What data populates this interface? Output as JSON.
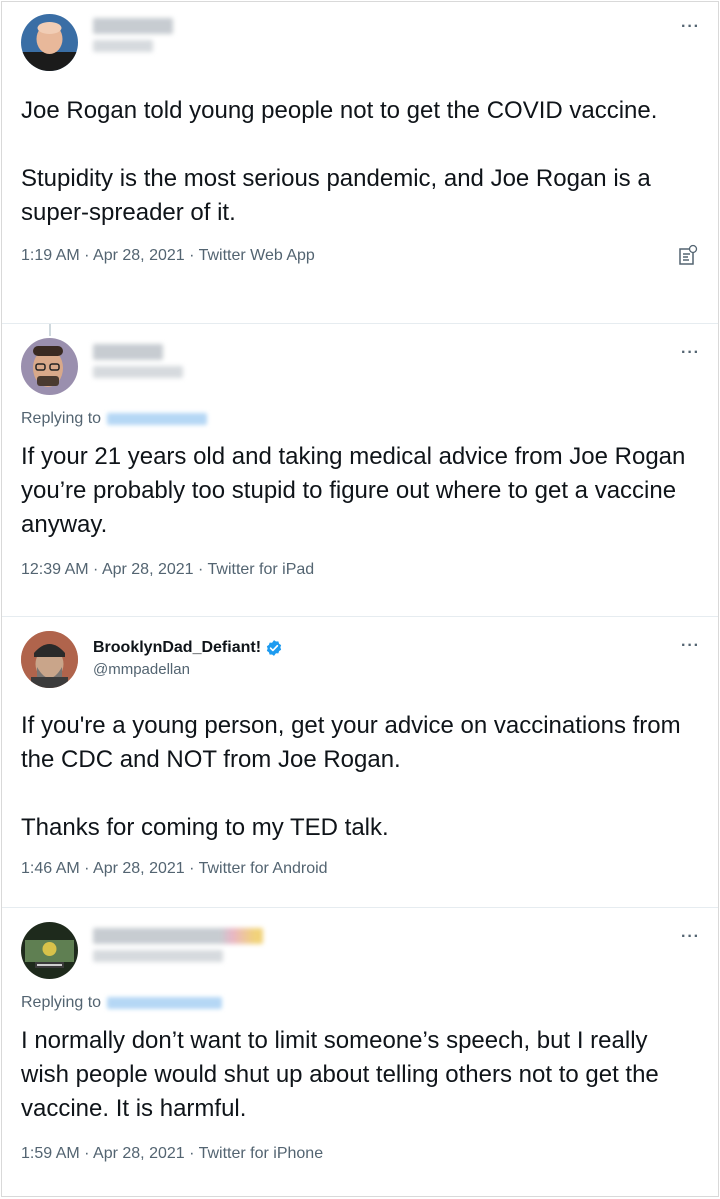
{
  "tweets": [
    {
      "display_name": "",
      "handle": "",
      "replying_to": "",
      "text": "Joe Rogan told young people not to get the COVID vaccine.\n\nStupidity is the most serious pandemic, and Joe Rogan is a super-spreader of it.",
      "meta": "1:19 AM · Apr 28, 2021 · Twitter Web App",
      "avatar_icon": "avatar-bald-man"
    },
    {
      "display_name": "",
      "handle": "",
      "replying_to_label": "Replying to",
      "text": "If your 21 years old and taking medical advice from Joe Rogan you’re probably too stupid to figure out where to get a vaccine anyway.",
      "meta": "12:39 AM · Apr 28, 2021 · Twitter for iPad",
      "avatar_icon": "avatar-man-glasses"
    },
    {
      "display_name": "BrooklynDad_Defiant!",
      "handle": "@mmpadellan",
      "text": "If you're a young person, get your advice on vaccinations from the CDC and NOT from Joe Rogan.\n\nThanks for coming to my TED talk.",
      "meta": "1:46 AM · Apr 28, 2021 · Twitter for Android",
      "avatar_icon": "avatar-bearded-man-beanie",
      "verified_color": "#1d9bf0"
    },
    {
      "display_name": "",
      "handle": "",
      "replying_to_label": "Replying to",
      "text": "I normally don’t want to limit someone’s speech, but I really wish people would shut up about telling others not to get the vaccine. It is harmful.",
      "meta": "1:59 AM · Apr 28, 2021 · Twitter for iPhone",
      "avatar_icon": "avatar-happy-bug-logo"
    }
  ],
  "more_label": "···"
}
